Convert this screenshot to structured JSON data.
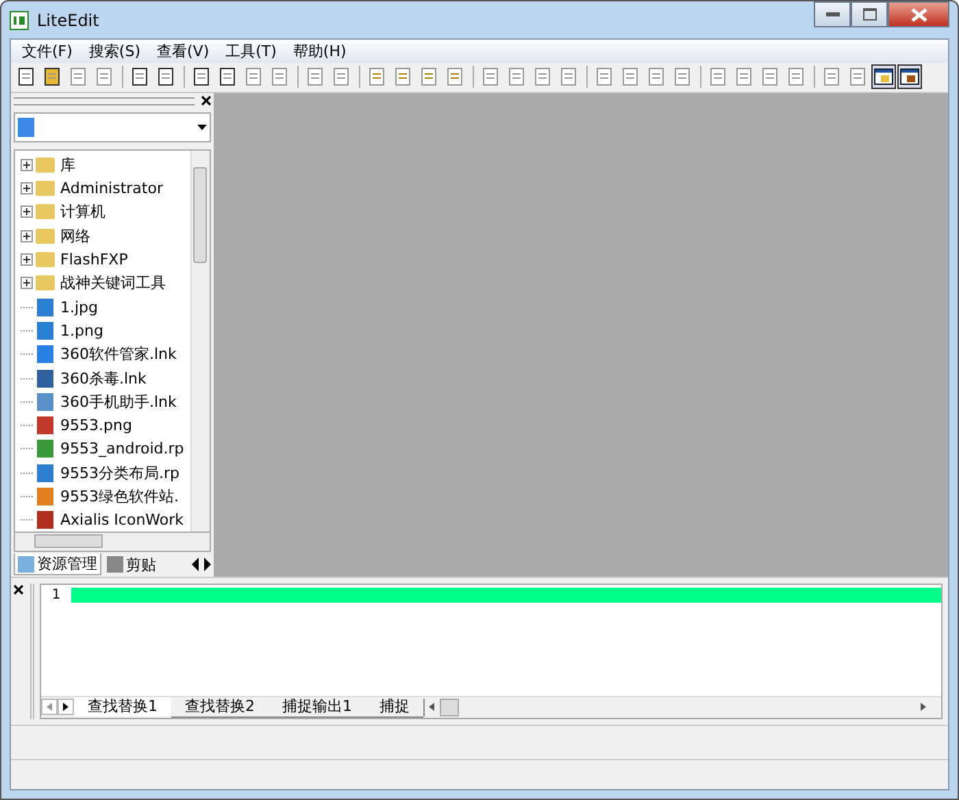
{
  "window": {
    "title": "LiteEdit"
  },
  "menu": [
    "文件(F)",
    "搜索(S)",
    "查看(V)",
    "工具(T)",
    "帮助(H)"
  ],
  "toolbar_toggles": [
    {
      "on": true
    },
    {
      "on": true
    }
  ],
  "sidebar": {
    "tree": [
      {
        "label": "库",
        "kind": "folder",
        "expanded": false
      },
      {
        "label": "Administrator",
        "kind": "folder",
        "expanded": false
      },
      {
        "label": "计算机",
        "kind": "folder",
        "expanded": false
      },
      {
        "label": "网络",
        "kind": "folder",
        "expanded": false
      },
      {
        "label": "FlashFXP",
        "kind": "folder",
        "expanded": false
      },
      {
        "label": "战神关键词工具",
        "kind": "folder",
        "expanded": false
      },
      {
        "label": "1.jpg",
        "kind": "file"
      },
      {
        "label": "1.png",
        "kind": "file"
      },
      {
        "label": "360软件管家.lnk",
        "kind": "file"
      },
      {
        "label": "360杀毒.lnk",
        "kind": "file"
      },
      {
        "label": "360手机助手.lnk",
        "kind": "file"
      },
      {
        "label": "9553.png",
        "kind": "file"
      },
      {
        "label": "9553_android.rp",
        "kind": "file"
      },
      {
        "label": "9553分类布局.rp",
        "kind": "file"
      },
      {
        "label": "9553绿色软件站.",
        "kind": "file"
      },
      {
        "label": "Axialis IconWork",
        "kind": "file"
      }
    ],
    "tabs": [
      {
        "label": "资源管理",
        "selected": true
      },
      {
        "label": "剪贴",
        "selected": false
      }
    ]
  },
  "editor": {
    "lines": [
      {
        "number": "1",
        "selected": true
      }
    ]
  },
  "bottom_tabs": [
    {
      "label": "查找替换1",
      "selected": true
    },
    {
      "label": "查找替换2",
      "selected": false
    },
    {
      "label": "捕捉输出1",
      "selected": false
    },
    {
      "label": "捕捉",
      "selected": false
    }
  ]
}
